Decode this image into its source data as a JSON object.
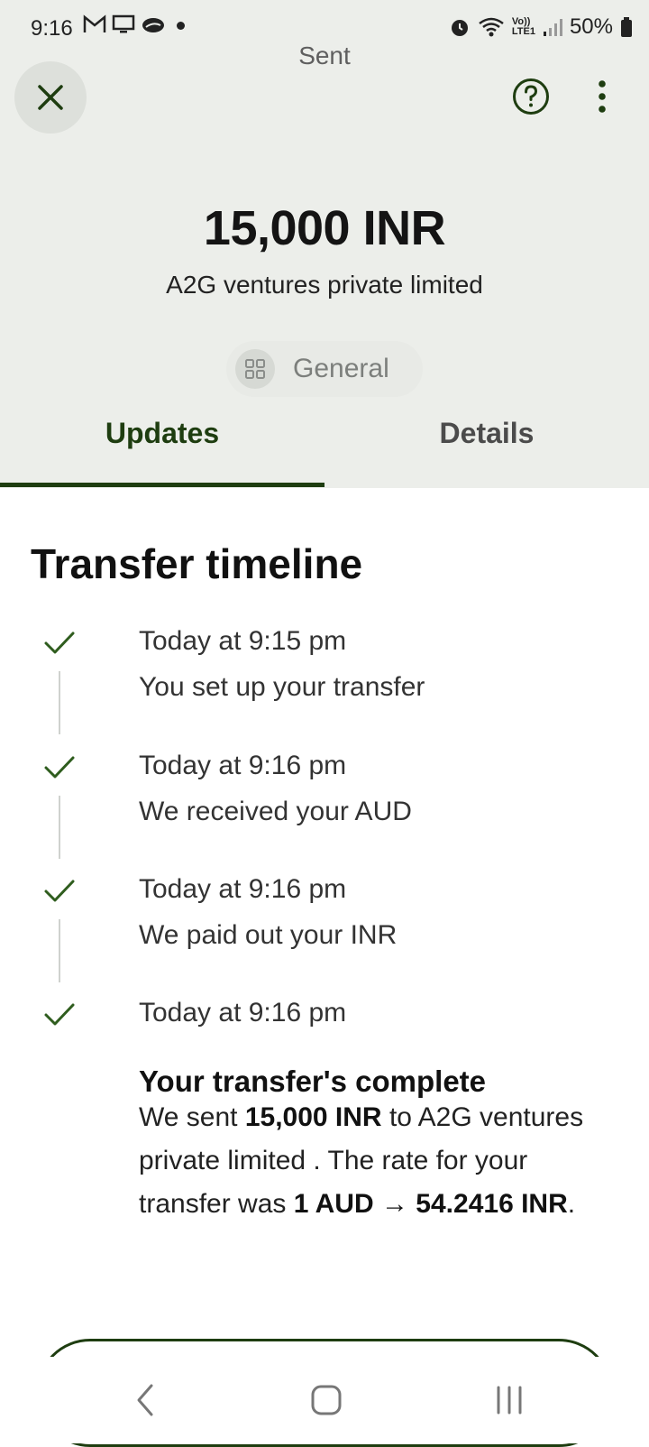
{
  "status_bar": {
    "time": "9:16",
    "left_icons": [
      "gmail-icon",
      "monitor-icon",
      "cloud-icon"
    ],
    "right_icons": [
      "alarm-icon",
      "wifi-icon",
      "volte-icon",
      "signal-icon",
      "battery-icon"
    ],
    "volte_label": "Vo))",
    "lte_label": "LTE1",
    "battery": "50%"
  },
  "header": {
    "title": "Sent",
    "close_icon": "close-icon",
    "help_icon": "help-icon",
    "more_icon": "more-vert-icon"
  },
  "transfer": {
    "amount": "15,000 INR",
    "recipient": "A2G ventures private limited",
    "category": "General",
    "category_icon": "grid-icon"
  },
  "tabs": [
    {
      "label": "Updates",
      "active": true
    },
    {
      "label": "Details",
      "active": false
    }
  ],
  "timeline": {
    "title": "Transfer timeline",
    "events": [
      {
        "time": "Today at 9:15 pm",
        "text": "You set up your transfer"
      },
      {
        "time": "Today at 9:16 pm",
        "text": "We received your AUD"
      },
      {
        "time": "Today at 9:16 pm",
        "text": "We paid out your INR"
      },
      {
        "time": "Today at 9:16 pm",
        "heading": "Your transfer's complete",
        "desc": {
          "part1": "We sent ",
          "amount": "15,000 INR",
          "part2": " to A2G ventures private limited . The rate for your transfer was ",
          "rate": "1 AUD → 54.2416 INR",
          "part3": "."
        }
      }
    ]
  },
  "colors": {
    "accent": "#1e3d10",
    "check": "#2f5d1e",
    "header_bg": "#eceeea"
  }
}
